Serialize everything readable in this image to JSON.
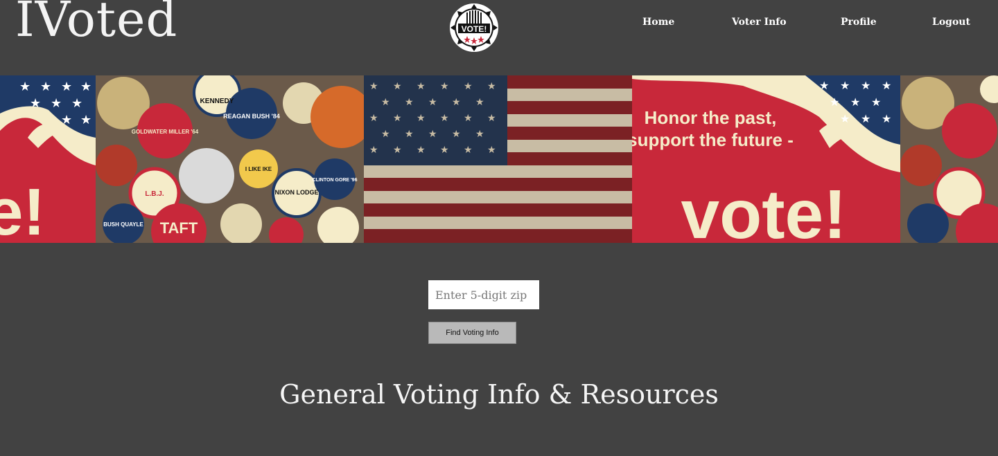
{
  "header": {
    "brand": "IVoted",
    "logo_text": "VOTE!",
    "nav": [
      {
        "label": "Home"
      },
      {
        "label": "Voter Info"
      },
      {
        "label": "Profile"
      },
      {
        "label": "Logout"
      }
    ]
  },
  "banner": {
    "poster_headline_line1": "Honor the past,",
    "poster_headline_line2": "support the future -",
    "poster_big_word": "vote!",
    "poster_partial_word": "e!",
    "buttons": [
      "KENNEDY",
      "REAGAN BUSH '84",
      "GOLDWATER MILLER '64",
      "TAFT",
      "CLINTON GORE '96",
      "NIXON LODGE",
      "BUSH QUAYLE",
      "L.B.J.",
      "I LIKE IKE"
    ]
  },
  "search": {
    "zip_placeholder": "Enter 5-digit zip",
    "button_label": "Find Voting Info"
  },
  "main": {
    "section_title": "General Voting Info & Resources"
  },
  "colors": {
    "background": "#424242",
    "poster_red": "#c8283a",
    "poster_cream": "#f5ecc9",
    "flag_blue": "#1f3a66"
  }
}
